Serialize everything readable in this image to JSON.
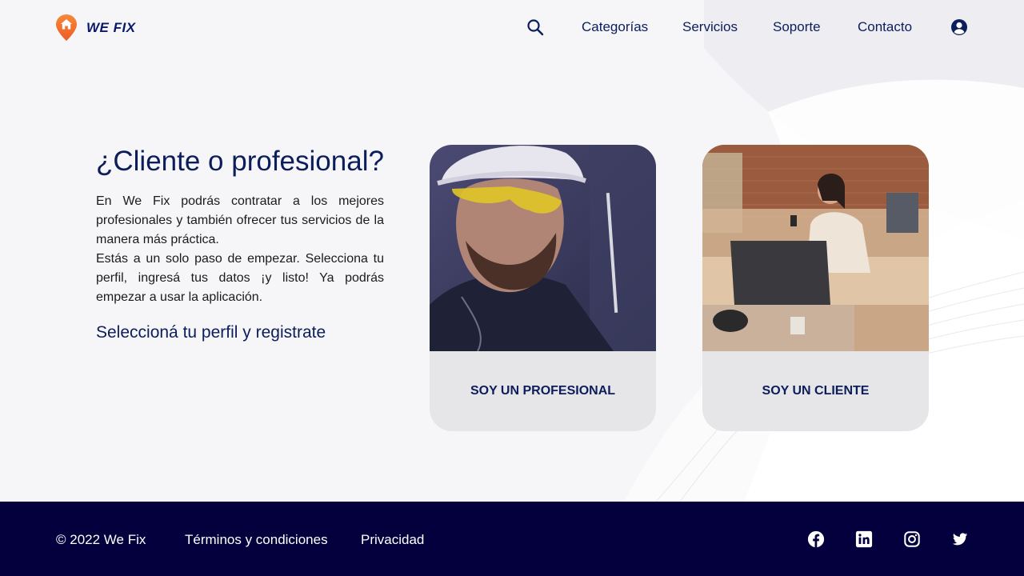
{
  "header": {
    "logo_text": "WE FIX",
    "nav": [
      "Categorías",
      "Servicios",
      "Soporte",
      "Contacto"
    ]
  },
  "intro": {
    "heading": "¿Cliente o profesional?",
    "paragraph_1": "En We Fix podrás contratar a los mejores profesionales y también ofrecer tus servicios de la manera más práctica.",
    "paragraph_2": "Estás a un solo paso de empezar. Selecciona tu perfil, ingresá tus datos ¡y listo! Ya podrás empezar a usar la aplicación.",
    "cta": "Seleccioná tu perfil y registrate"
  },
  "cards": {
    "professional_label": "SOY UN PROFESIONAL",
    "client_label": "SOY UN CLIENTE"
  },
  "footer": {
    "copyright": "© 2022 We Fix",
    "terms": "Términos y condiciones",
    "privacy": "Privacidad",
    "social_icons": [
      "facebook-icon",
      "linkedin-icon",
      "instagram-icon",
      "twitter-icon"
    ]
  },
  "colors": {
    "brand_navy": "#0c1d5c",
    "footer_bg": "#03003d",
    "logo_orange": "#f46a28",
    "card_bg": "#e6e6e8"
  }
}
